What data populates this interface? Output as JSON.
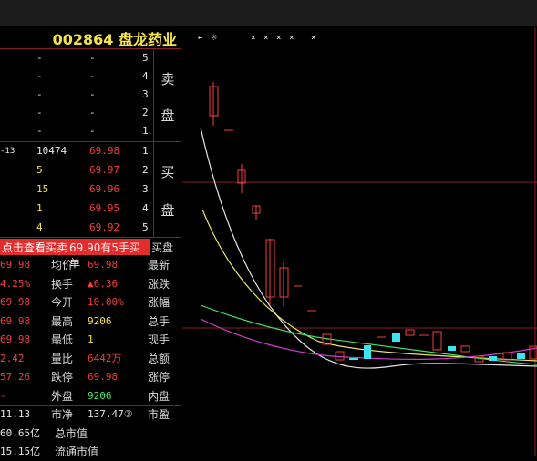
{
  "stock": {
    "title": "002864 盘龙药业"
  },
  "toolbar": {
    "items": [
      "←",
      "×",
      "×",
      "×",
      "×",
      "×",
      "×"
    ]
  },
  "orderbook": {
    "sell_label_1": "卖",
    "sell_label_2": "盘",
    "buy_label_1": "买",
    "buy_label_2": "盘",
    "sell": [
      {
        "level": "5",
        "price": "-",
        "volume": "-"
      },
      {
        "level": "4",
        "price": "-",
        "volume": "-"
      },
      {
        "level": "3",
        "price": "-",
        "volume": "-"
      },
      {
        "level": "2",
        "price": "-",
        "volume": "-"
      },
      {
        "level": "1",
        "price": "-",
        "volume": "-"
      }
    ],
    "buy": [
      {
        "level": "1",
        "price": "69.98",
        "volume": "10474",
        "extra": "-13"
      },
      {
        "level": "2",
        "price": "69.97",
        "volume": "5"
      },
      {
        "level": "3",
        "price": "69.96",
        "volume": "15"
      },
      {
        "level": "4",
        "price": "69.95",
        "volume": "1"
      },
      {
        "level": "5",
        "price": "69.92",
        "volume": "4"
      }
    ]
  },
  "banner": {
    "left": "点击查看",
    "middle": "买卖",
    "right": "69.90有5手买单",
    "tag": "买盘"
  },
  "stats": [
    {
      "v1": "69.98",
      "l1": "均价",
      "v2": "69.98",
      "l2": "最新"
    },
    {
      "v1": "4.25%",
      "l1": "换手",
      "v2": "▲6.36",
      "l2": "涨跌"
    },
    {
      "v1": "69.98",
      "l1": "今开",
      "v2": "10.00%",
      "l2": "涨幅"
    },
    {
      "v1": "69.98",
      "l1": "最高",
      "v2": "9206",
      "l2": "总手"
    },
    {
      "v1": "69.98",
      "l1": "最低",
      "v2": "1",
      "l2": "现手"
    },
    {
      "v1": "2.42",
      "l1": "量比",
      "v2": "6442万",
      "l2": "总额"
    },
    {
      "v1": "57.26",
      "l1": "跌停",
      "v2": "69.98",
      "l2": "涨停"
    },
    {
      "v1": "-",
      "l1": "外盘",
      "v2": "9206",
      "l2": "内盘"
    },
    {
      "v1": "11.13",
      "l1": "市净",
      "v2": "137.47③",
      "l2": "市盈"
    },
    {
      "v1": "60.65亿",
      "l1": "总市值",
      "v2": "",
      "l2": ""
    },
    {
      "v1": "15.15亿",
      "l1": "流通市值",
      "v2": "",
      "l2": ""
    }
  ],
  "colors": {
    "red": "#f23e3e",
    "yellow": "#f5e34a",
    "green": "#3fe46a",
    "grid": "#8a1e1e",
    "cyan": "#3ce3f0"
  }
}
